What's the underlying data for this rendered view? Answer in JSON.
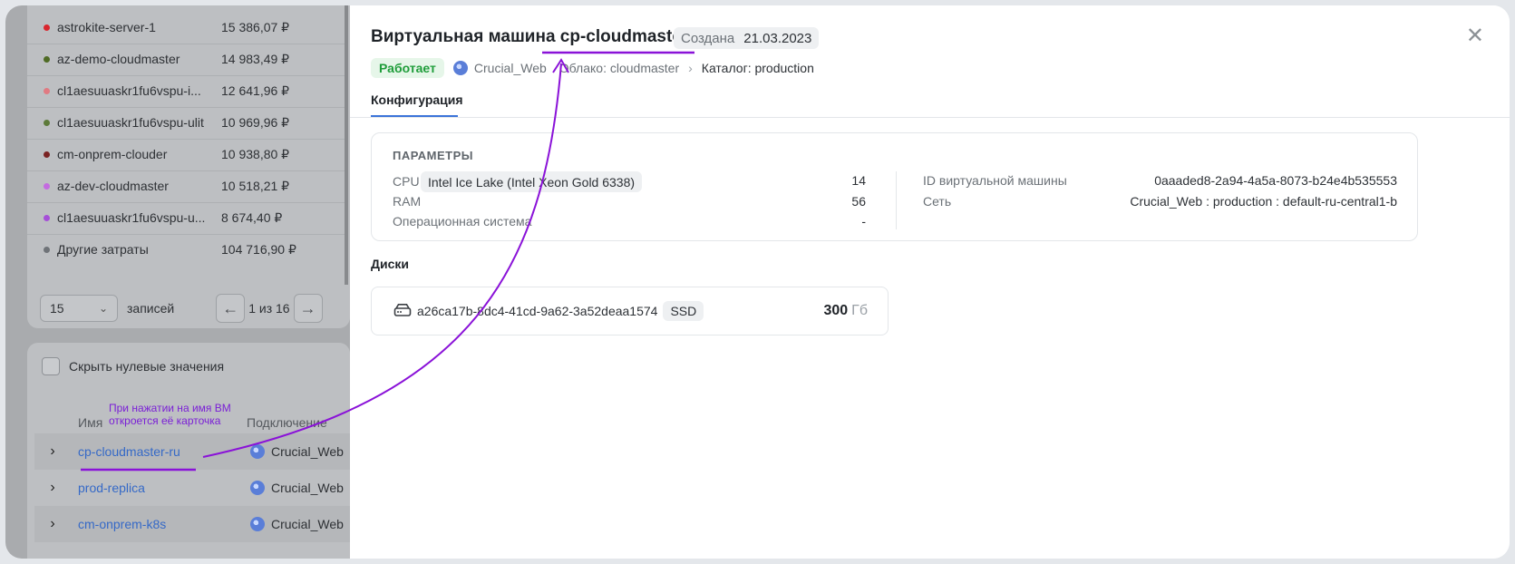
{
  "costs": {
    "rows": [
      {
        "name": "astrokite-server-1",
        "value": "15 386,07 ₽",
        "color": "#d9262e"
      },
      {
        "name": "az-demo-cloudmaster",
        "value": "14 983,49 ₽",
        "color": "#4f6b25"
      },
      {
        "name": "cl1aesuuaskr1fu6vspu-i...",
        "value": "12 641,96 ₽",
        "color": "#e07a82"
      },
      {
        "name": "cl1aesuuaskr1fu6vspu-ulit",
        "value": "10 969,96 ₽",
        "color": "#5d7a3a"
      },
      {
        "name": "cm-onprem-clouder",
        "value": "10 938,80 ₽",
        "color": "#7a2323"
      },
      {
        "name": "az-dev-cloudmaster",
        "value": "10 518,21 ₽",
        "color": "#c46be0"
      },
      {
        "name": "cl1aesuuaskr1fu6vspu-u...",
        "value": "8 674,40 ₽",
        "color": "#a64fd8"
      },
      {
        "name": "Другие затраты",
        "value": "104 716,90 ₽",
        "color": "#6f7378"
      }
    ],
    "page_size": "15",
    "records_label": "записей",
    "page_info": "1 из 16"
  },
  "vm_table": {
    "hide_zero_label": "Скрыть нулевые значения",
    "col_name": "Имя",
    "col_conn": "Подключение",
    "rows": [
      {
        "name": "cp-cloudmaster-ru",
        "conn": "Crucial_Web"
      },
      {
        "name": "prod-replica",
        "conn": "Crucial_Web"
      },
      {
        "name": "cm-onprem-k8s",
        "conn": "Crucial_Web"
      }
    ]
  },
  "annotation": {
    "line1": "При нажатии на имя ВМ",
    "line2": "откроется её карточка",
    "color": "#7a1fd6"
  },
  "card": {
    "title_prefix": "Виртуальная машина",
    "title_name": "cp-cloudmaster-ru",
    "created_label": "Создана",
    "created_date": "21.03.2023",
    "status": "Работает",
    "connection": "Crucial_Web",
    "breadcrumb_cloud": "Облако: cloudmaster",
    "breadcrumb_catalog": "Каталог: production",
    "tab": "Конфигурация",
    "params_header": "ПАРАМЕТРЫ",
    "cpu_label": "CPU",
    "cpu_model": "Intel Ice Lake (Intel Xeon Gold 6338)",
    "cpu_value": "14",
    "ram_label": "RAM",
    "ram_value": "56",
    "os_label": "Операционная система",
    "os_value": "-",
    "vmid_label": "ID виртуальной машины",
    "vmid_value": "0aaaded8-2a94-4a5a-8073-b24e4b535553",
    "net_label": "Сеть",
    "net_value": "Crucial_Web : production : default-ru-central1-b",
    "disks_header": "Диски",
    "disk_id": "a26ca17b-8dc4-41cd-9a62-3a52deaa1574",
    "disk_type": "SSD",
    "disk_size": "300",
    "disk_unit": "Гб"
  },
  "colors": {
    "accent": "#3b74d9",
    "status_green": "#1f9d3a",
    "link": "#3569c7"
  }
}
